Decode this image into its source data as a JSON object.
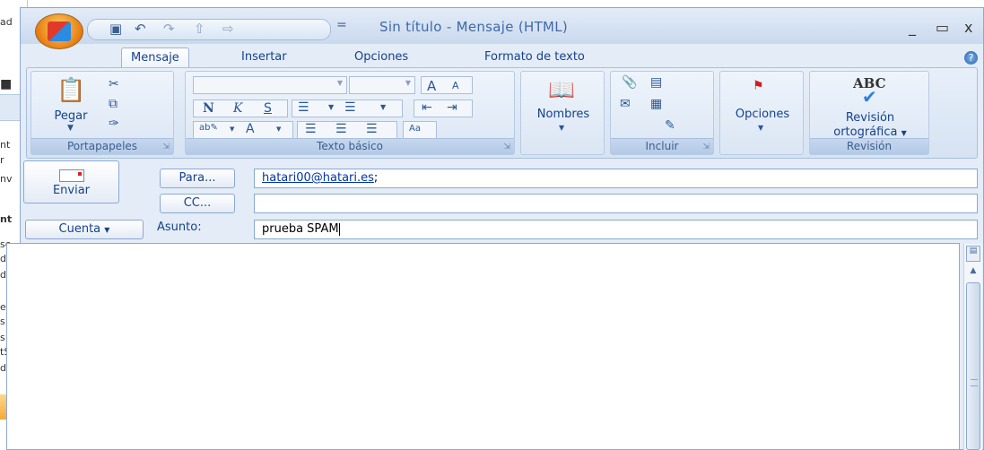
{
  "background_window": {
    "fragments": [
      "ad",
      "nt",
      "r",
      "nv",
      "nt",
      "sc",
      "de",
      "de",
      "ec",
      "s",
      "s",
      "tS",
      "de"
    ]
  },
  "window": {
    "title": "Sin título - Mensaje (HTML)",
    "controls": {
      "minimize": "_",
      "maximize": "▭",
      "close": "x"
    }
  },
  "quick_access": {
    "items": [
      "save-icon",
      "undo-icon",
      "redo-icon",
      "up-icon",
      "down-icon"
    ],
    "dropdown": "="
  },
  "tabs": [
    "Mensaje",
    "Insertar",
    "Opciones",
    "Formato de texto"
  ],
  "ribbon": {
    "groups": {
      "clipboard": {
        "label": "Portapapeles",
        "paste": "Pegar"
      },
      "basic_text": {
        "label": "Texto básico",
        "bold": "N",
        "italic": "K",
        "underline": "S",
        "grow": "A",
        "shrink": "A",
        "font_color": "A"
      },
      "names": {
        "label": "Nombres"
      },
      "include": {
        "label": "Incluir"
      },
      "options": {
        "label": "Opciones"
      },
      "proofing": {
        "label": "Revisión",
        "spelling_line1": "Revisión",
        "spelling_line2": "ortográfica",
        "abc": "ABC"
      }
    }
  },
  "form": {
    "send_label": "Enviar",
    "to_button": "Para...",
    "cc_button": "CC...",
    "account_button": "Cuenta",
    "subject_label": "Asunto:",
    "to_value": "hatari00@hatari.es",
    "to_separator": ";",
    "cc_value": "",
    "subject_value": "prueba SPAM"
  },
  "colors": {
    "ribbon_bg": "#d6e3f3",
    "accent": "#15428b",
    "office_button": "#e87d10"
  }
}
